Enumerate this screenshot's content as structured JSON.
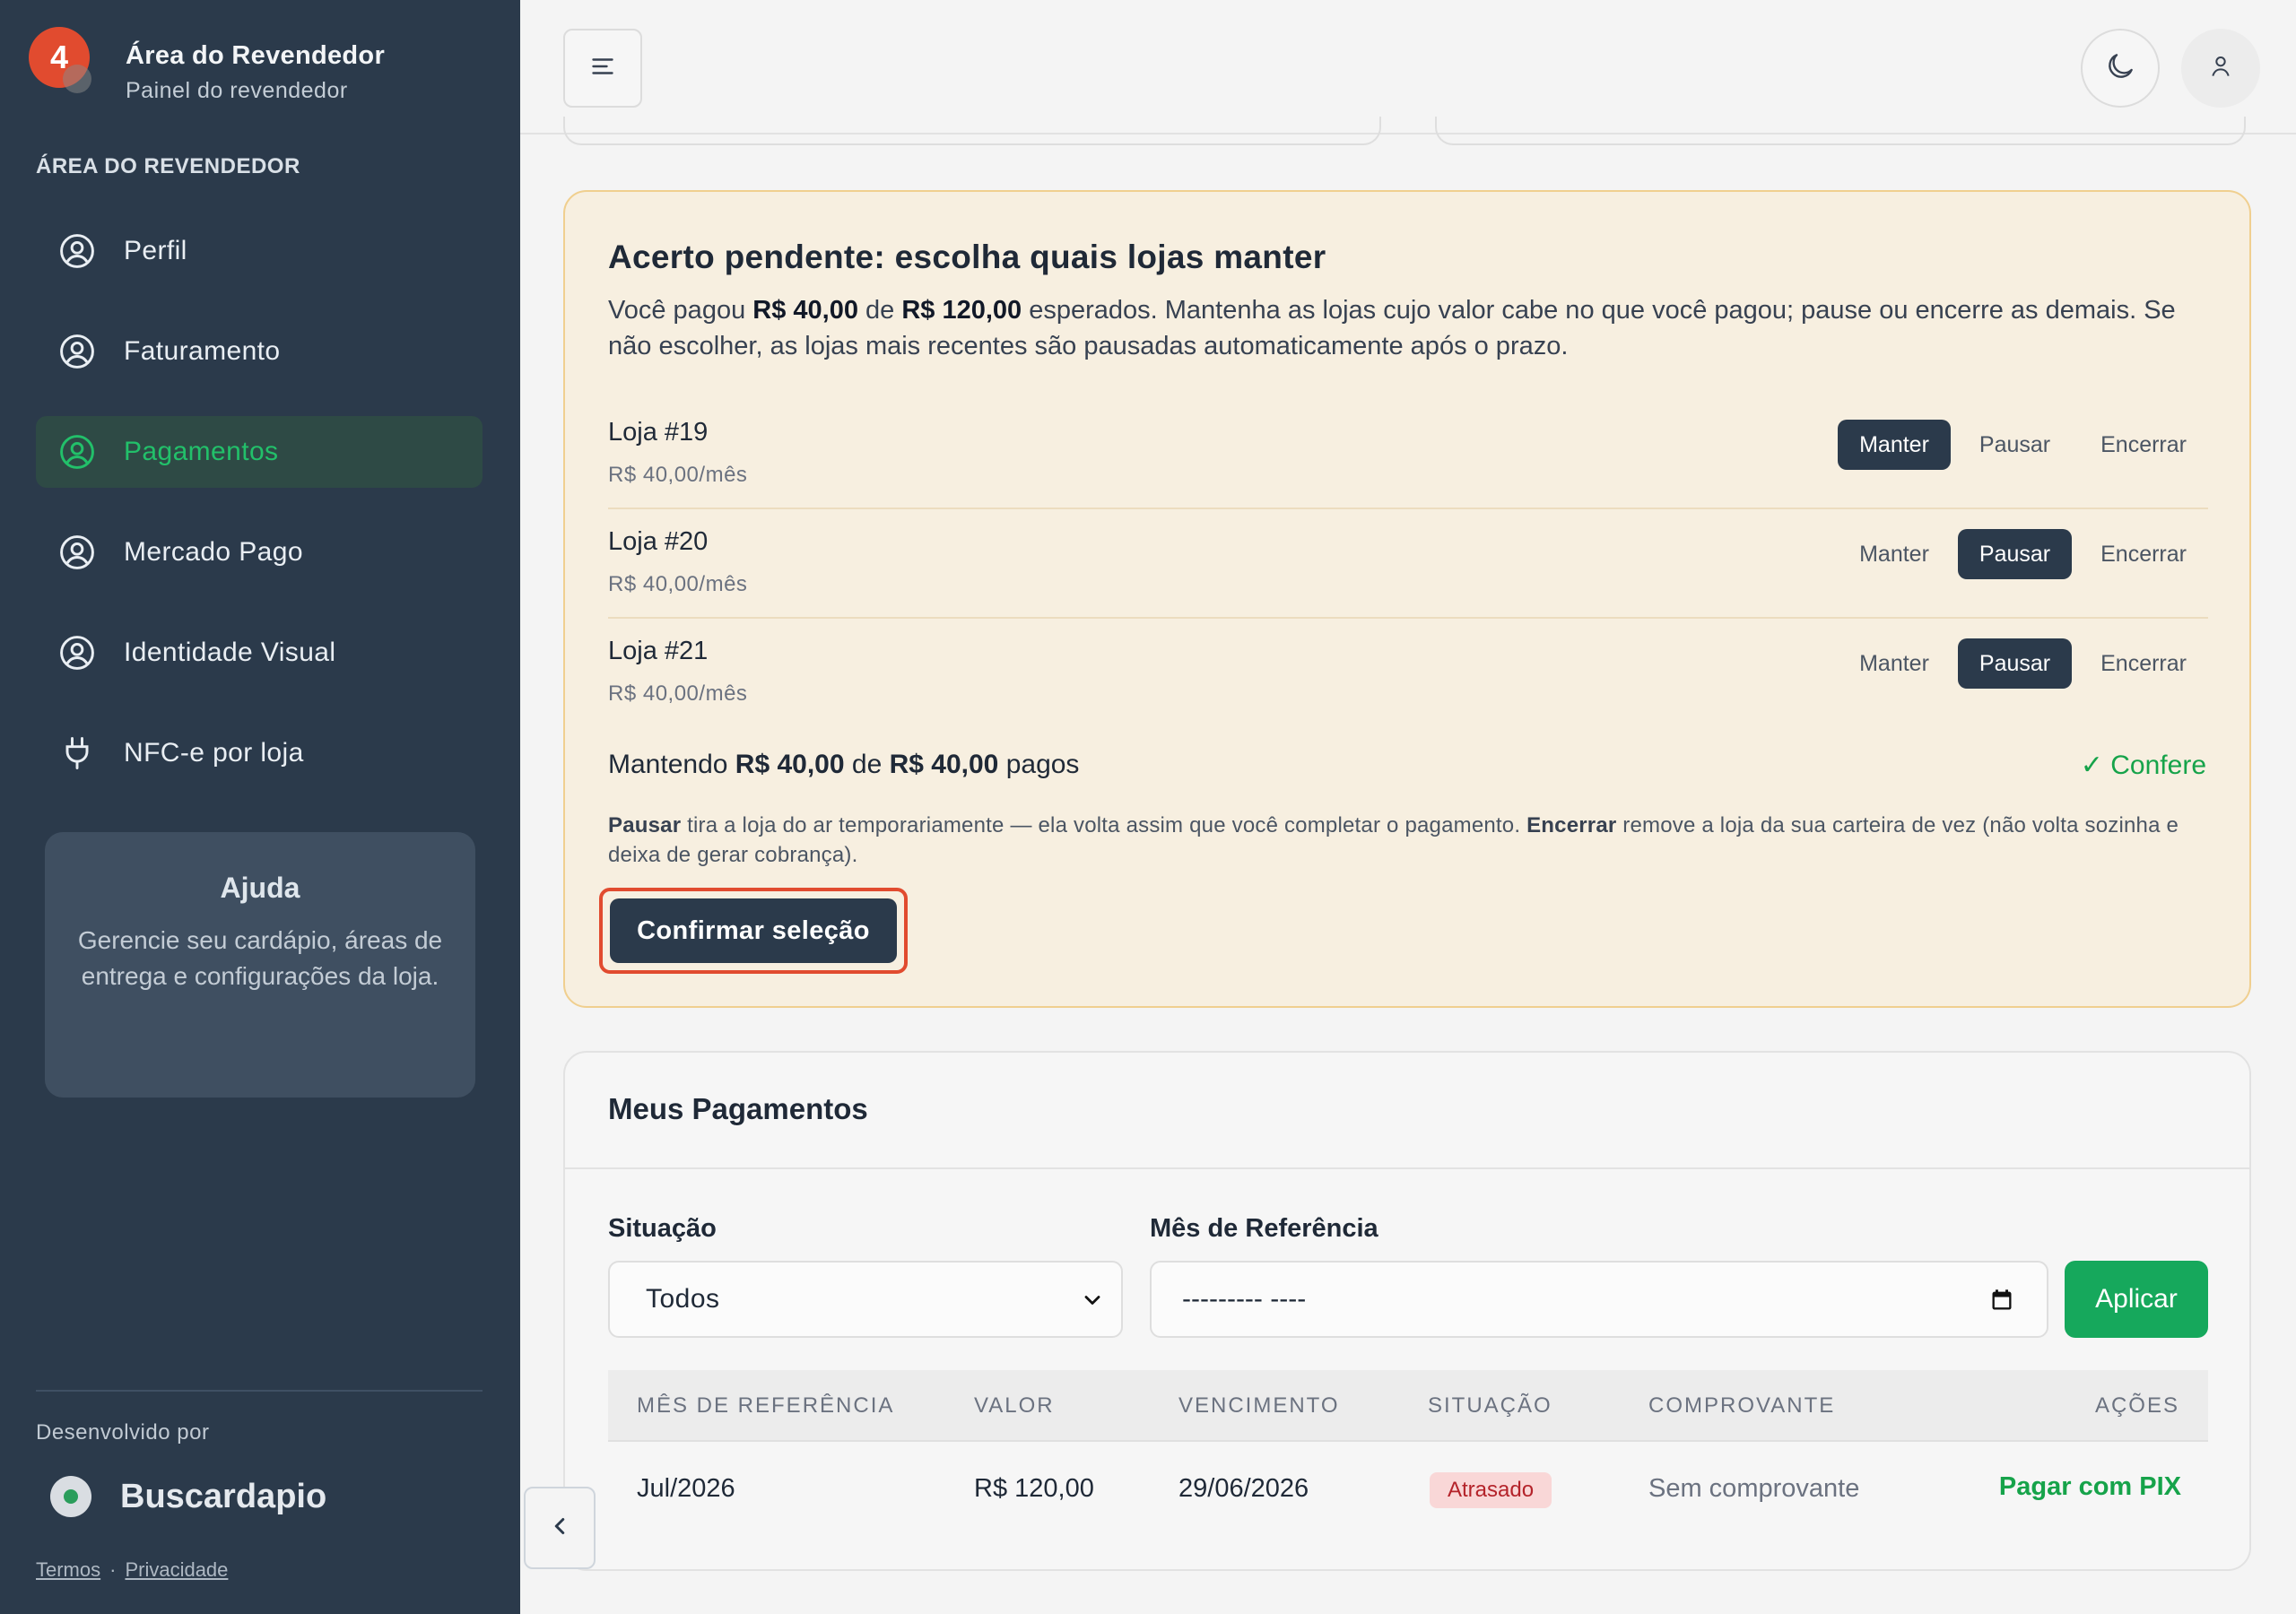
{
  "brand": {
    "badge": "4",
    "title": "Área do Revendedor",
    "subtitle": "Painel do revendedor"
  },
  "sidebar": {
    "section_label": "ÁREA DO REVENDEDOR",
    "items": [
      {
        "label": "Perfil",
        "icon": "user-circle-icon",
        "active": false
      },
      {
        "label": "Faturamento",
        "icon": "user-circle-icon",
        "active": false
      },
      {
        "label": "Pagamentos",
        "icon": "user-circle-icon",
        "active": true
      },
      {
        "label": "Mercado Pago",
        "icon": "user-circle-icon",
        "active": false
      },
      {
        "label": "Identidade Visual",
        "icon": "user-circle-icon",
        "active": false
      },
      {
        "label": "NFC-e por loja",
        "icon": "plug-icon",
        "active": false
      }
    ],
    "help": {
      "title": "Ajuda",
      "text": "Gerencie seu cardápio, áreas de entrega e configurações da loja."
    },
    "footer": {
      "dev_label": "Desenvolvido por",
      "dev_name": "Buscardapio",
      "terms": "Termos",
      "separator": "·",
      "privacy": "Privacidade"
    }
  },
  "topbar": {
    "menu_icon": "menu-icon",
    "theme_icon": "moon-icon",
    "user_icon": "user-icon"
  },
  "pending": {
    "title": "Acerto pendente: escolha quais lojas manter",
    "desc_1": "Você pagou ",
    "paid": "R$ 40,00",
    "desc_2": " de ",
    "expected": "R$ 120,00",
    "desc_3": " esperados. Mantenha as lojas cujo valor cabe no que você pagou; pause ou encerre as demais. Se não escolher, as lojas mais recentes são pausadas automaticamente após o prazo.",
    "stores": [
      {
        "name": "Loja #19",
        "price": "R$ 40,00/mês",
        "selected": "Manter"
      },
      {
        "name": "Loja #20",
        "price": "R$ 40,00/mês",
        "selected": "Pausar"
      },
      {
        "name": "Loja #21",
        "price": "R$ 40,00/mês",
        "selected": "Pausar"
      }
    ],
    "options": [
      "Manter",
      "Pausar",
      "Encerrar"
    ],
    "summary_1": "Mantendo ",
    "summary_kept": "R$ 40,00",
    "summary_2": " de ",
    "summary_paid": "R$ 40,00",
    "summary_3": " pagos",
    "confere": "✓ Confere",
    "note_pausar": "Pausar",
    "note_1": " tira a loja do ar temporariamente — ela volta assim que você completar o pagamento. ",
    "note_encerrar": "Encerrar",
    "note_2": " remove a loja da sua carteira de vez (não volta sozinha e deixa de gerar cobrança).",
    "confirm_label": "Confirmar seleção"
  },
  "payments": {
    "title": "Meus Pagamentos",
    "status_label": "Situação",
    "status_value": "Todos",
    "month_label": "Mês de Referência",
    "month_placeholder": "--------- ----",
    "apply_label": "Aplicar",
    "columns": [
      "MÊS DE REFERÊNCIA",
      "VALOR",
      "VENCIMENTO",
      "SITUAÇÃO",
      "COMPROVANTE",
      "AÇÕES"
    ],
    "rows": [
      {
        "month": "Jul/2026",
        "value": "R$ 120,00",
        "due": "29/06/2026",
        "status": "Atrasado",
        "receipt": "Sem comprovante",
        "action": "Pagar com PIX"
      }
    ]
  },
  "colors": {
    "sidebar_bg": "#2b3a4b",
    "accent_green": "#16a85c",
    "pending_bg": "#f7efe0",
    "highlight": "#e14b2f"
  }
}
